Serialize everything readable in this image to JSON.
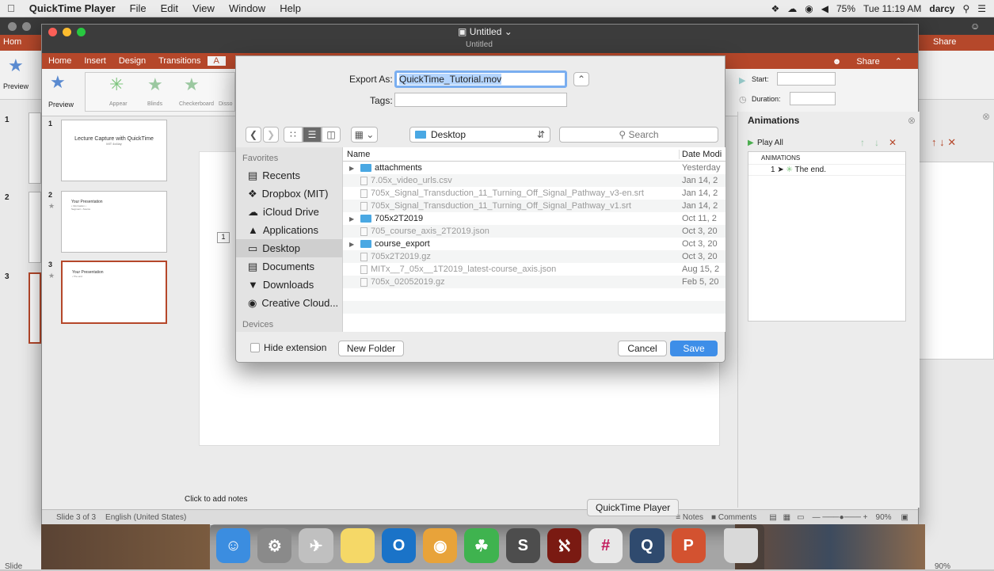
{
  "menubar": {
    "apple": "",
    "app": "QuickTime Player",
    "items": [
      "File",
      "Edit",
      "View",
      "Window",
      "Help"
    ],
    "battery": "75%",
    "clock": "Tue 11:19 AM",
    "user": "darcy"
  },
  "back_window": {
    "tab_home": "Hom",
    "share": "Share",
    "preview": "Preview",
    "slide_numbers": [
      "1",
      "2",
      "3"
    ],
    "status_left": "Slide",
    "zoom": "90%"
  },
  "front_window": {
    "title": "Untitled",
    "subtitle": "Untitled",
    "tabs": [
      "Home",
      "Insert",
      "Design",
      "Transitions",
      "A"
    ],
    "share": "Share",
    "ribbon": {
      "preview": "Preview",
      "effects": [
        "Appear",
        "Blinds",
        "Checkerboard",
        "Disso"
      ],
      "start_label": "Start:",
      "duration_label": "Duration:"
    },
    "slides": [
      {
        "num": "1",
        "title": "Lecture Capture with QuickTime",
        "sub": "MIT 4x4lay"
      },
      {
        "num": "2",
        "title": "Your Presentation",
        "sub": "• Information • Segment • Source"
      },
      {
        "num": "3",
        "title": "Your Presentation",
        "sub": "• The end"
      }
    ],
    "page_indicator": "1",
    "notes_placeholder": "Click to add notes",
    "animations": {
      "title": "Animations",
      "play_all": "Play All",
      "section": "ANIMATIONS",
      "item_num": "1",
      "item_label": "The end."
    },
    "status": {
      "slide": "Slide 3 of 3",
      "language": "English (United States)",
      "notes": "Notes",
      "comments": "Comments",
      "zoom": "90%"
    }
  },
  "dialog": {
    "export_label": "Export As:",
    "export_value": "QuickTime_Tutorial.mov",
    "tags_label": "Tags:",
    "location": "Desktop",
    "search_placeholder": "Search",
    "sidebar": {
      "favorites_heading": "Favorites",
      "favorites": [
        "Recents",
        "Dropbox (MIT)",
        "iCloud Drive",
        "Applications",
        "Desktop",
        "Documents",
        "Downloads",
        "Creative Cloud..."
      ],
      "devices_heading": "Devices"
    },
    "columns": {
      "name": "Name",
      "date": "Date Modi"
    },
    "files": [
      {
        "name": "attachments",
        "date": "Yesterday",
        "type": "folder"
      },
      {
        "name": "7.05x_video_urls.csv",
        "date": "Jan 14, 2",
        "type": "file"
      },
      {
        "name": "705x_Signal_Transduction_11_Turning_Off_Signal_Pathway_v3-en.srt",
        "date": "Jan 14, 2",
        "type": "file"
      },
      {
        "name": "705x_Signal_Transduction_11_Turning_Off_Signal_Pathway_v1.srt",
        "date": "Jan 14, 2",
        "type": "file"
      },
      {
        "name": "705x2T2019",
        "date": "Oct 11, 2",
        "type": "folder"
      },
      {
        "name": "705_course_axis_2T2019.json",
        "date": "Oct 3, 20",
        "type": "file"
      },
      {
        "name": "course_export",
        "date": "Oct 3, 20",
        "type": "folder"
      },
      {
        "name": "705x2T2019.gz",
        "date": "Oct 3, 20",
        "type": "file"
      },
      {
        "name": "MITx__7_05x__1T2019_latest-course_axis.json",
        "date": "Aug 15, 2",
        "type": "file"
      },
      {
        "name": "705x_02052019.gz",
        "date": "Feb 5, 20",
        "type": "file"
      }
    ],
    "hide_extension": "Hide extension",
    "new_folder": "New Folder",
    "cancel": "Cancel",
    "save": "Save"
  },
  "dock": {
    "tooltip": "QuickTime Player",
    "icons": [
      "finder-icon",
      "system-preferences-icon",
      "launchpad-icon",
      "notes-icon",
      "outlook-icon",
      "chrome-icon",
      "evernote-icon",
      "sublime-icon",
      "acrobat-icon",
      "slack-icon",
      "quicktime-icon",
      "powerpoint-icon",
      "trash-icon"
    ]
  },
  "colors": {
    "ribbon": "#b5472a",
    "accent": "#3e8ee8",
    "selection": "#b5d5fd"
  }
}
